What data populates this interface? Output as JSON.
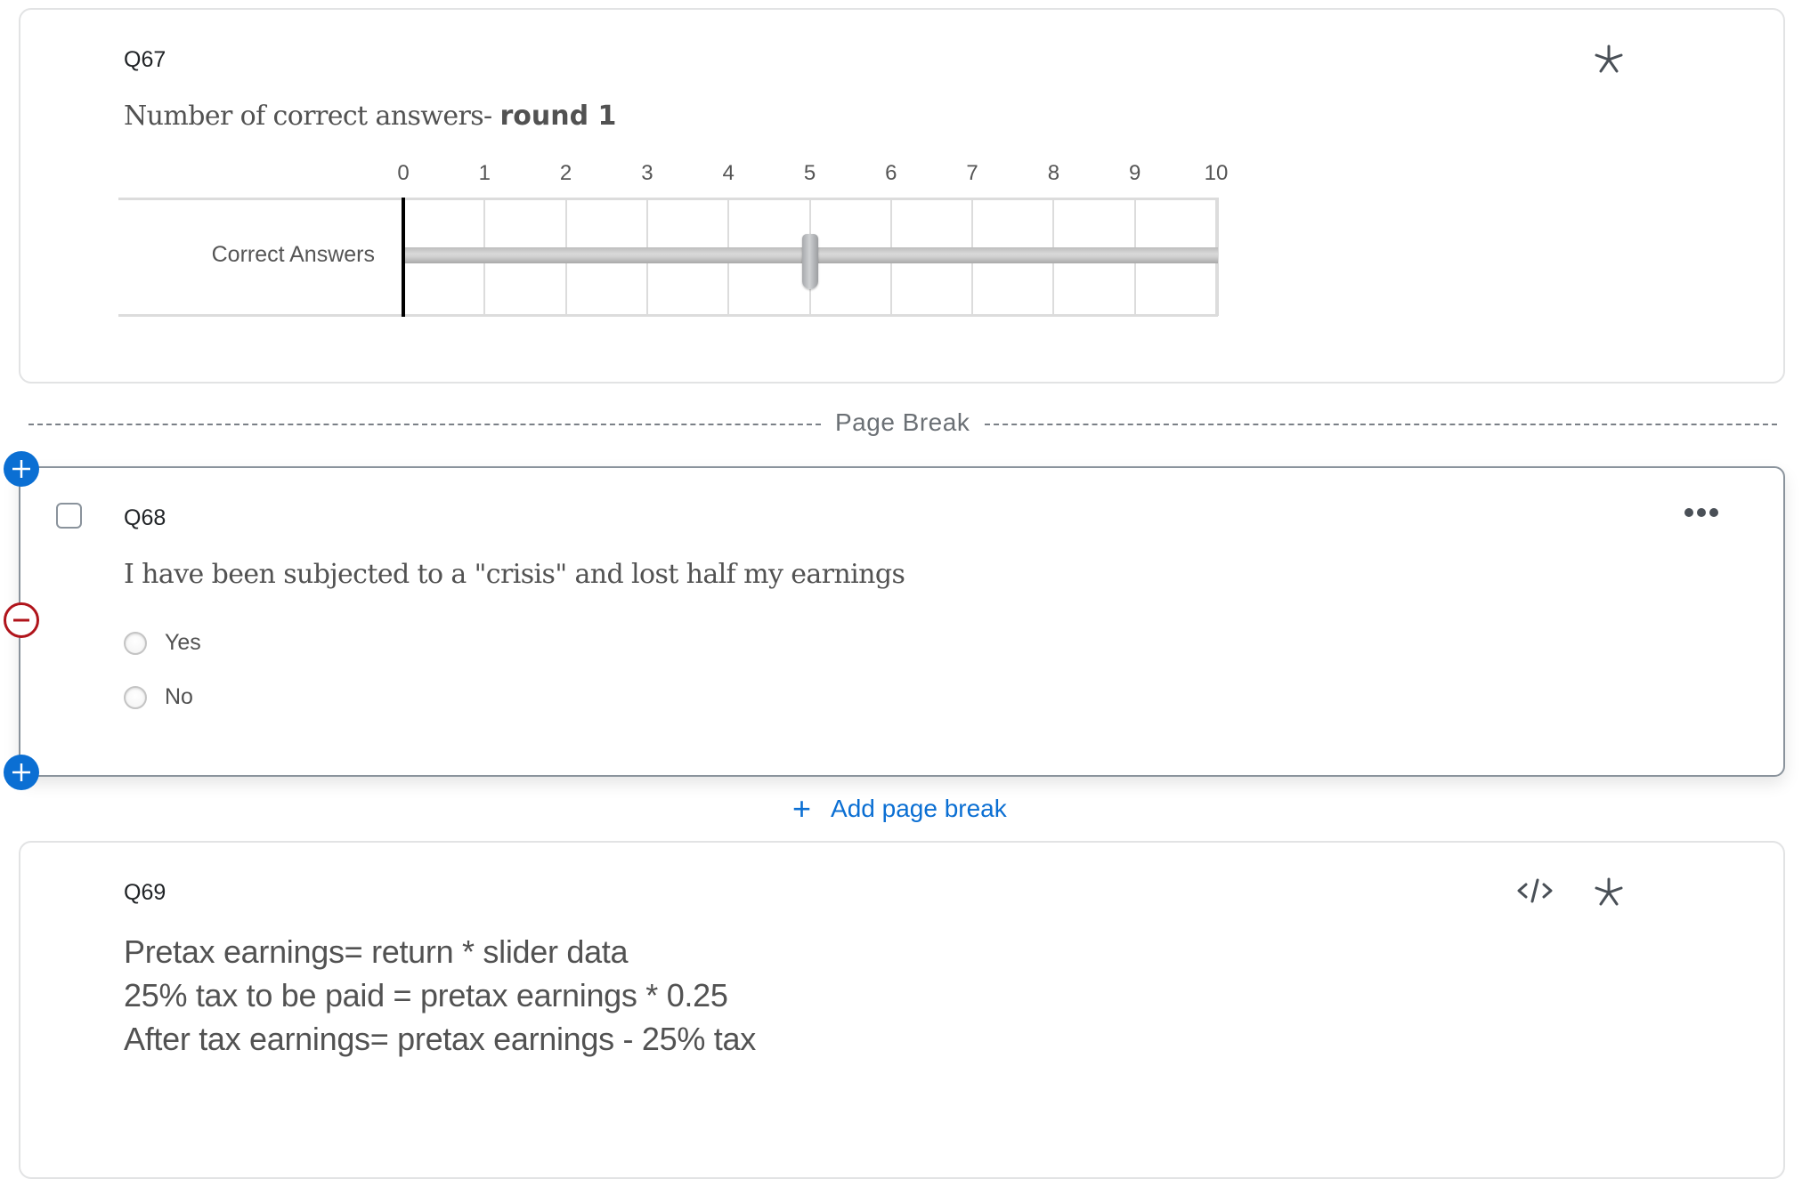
{
  "questions": {
    "q67": {
      "id": "Q67",
      "text_regular": "Number of correct answers- ",
      "text_bold": "round 1",
      "required_icon": "asterisk-icon",
      "slider": {
        "min": 0,
        "max": 10,
        "ticks": [
          "0",
          "1",
          "2",
          "3",
          "4",
          "5",
          "6",
          "7",
          "8",
          "9",
          "10"
        ],
        "row_label": "Correct Answers",
        "value": 5
      }
    },
    "page_break": {
      "label": "Page Break"
    },
    "q68": {
      "id": "Q68",
      "text": "I have been subjected to a \"crisis\" and lost half my earnings",
      "options": [
        {
          "label": "Yes",
          "selected": false
        },
        {
          "label": "No",
          "selected": false
        }
      ],
      "more_icon": "ellipsis-icon"
    },
    "add_page_break": {
      "icon": "plus-icon",
      "label": "Add page break"
    },
    "q69": {
      "id": "Q69",
      "lines": [
        "Pretax earnings= return * slider data",
        "25% tax to be paid = pretax earnings * 0.25",
        "After tax earnings=  pretax earnings - 25% tax"
      ],
      "icons": [
        "code-icon",
        "asterisk-icon"
      ]
    }
  },
  "colors": {
    "accent_blue": "#0b6fd3",
    "remove_red": "#b0141b",
    "selected_border": "#8a939c"
  }
}
